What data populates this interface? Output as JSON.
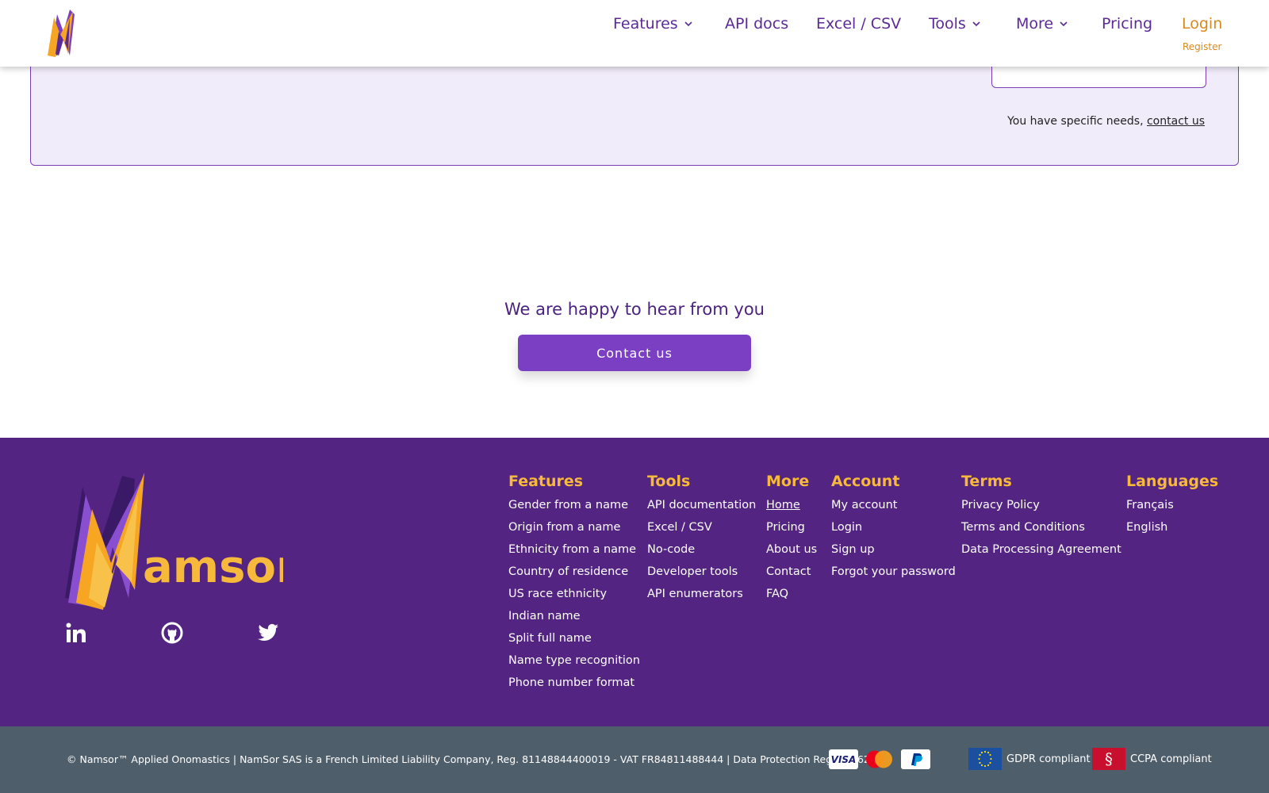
{
  "header": {
    "nav": {
      "features": "Features",
      "api_docs": "API docs",
      "excel_csv": "Excel / CSV",
      "tools": "Tools",
      "more": "More",
      "pricing": "Pricing",
      "login": "Login",
      "register": "Register"
    },
    "logo_icon": "namsor-bolt-logo"
  },
  "panel": {
    "needs_text": "You have specific needs, ",
    "contact_link": "contact us"
  },
  "cta": {
    "title": "We are happy to hear from you",
    "button": "Contact us"
  },
  "footer": {
    "brand": "amsor",
    "social": [
      "linkedin-icon",
      "github-icon",
      "twitter-icon"
    ],
    "columns": {
      "features": {
        "title": "Features",
        "items": [
          "Gender from a name",
          "Origin from a name",
          "Ethnicity from a name",
          "Country of residence",
          "US race ethnicity",
          "Indian name",
          "Split full name",
          "Name type recognition",
          "Phone number format"
        ]
      },
      "tools": {
        "title": "Tools",
        "items": [
          "API documentation",
          "Excel / CSV",
          "No-code",
          "Developer tools",
          "API enumerators"
        ]
      },
      "more": {
        "title": "More",
        "items": [
          "Home",
          "Pricing",
          "About us",
          "Contact",
          "FAQ"
        ]
      },
      "account": {
        "title": "Account",
        "items": [
          "My account",
          "Login",
          "Sign up",
          "Forgot your password"
        ]
      },
      "terms": {
        "title": "Terms",
        "items": [
          "Privacy Policy",
          "Terms and Conditions",
          "Data Processing Agreement"
        ]
      },
      "languages": {
        "title": "Languages",
        "items": [
          "Français",
          "English"
        ]
      }
    }
  },
  "bottom": {
    "copyright": "© Namsor™ Applied Onomastics | NamSor SAS is a French Limited Liability Company, Reg. 81148844400019 - VAT FR84811488444 | Data Protection Reg. 1876223",
    "payments": [
      "visa-icon",
      "mastercard-icon",
      "paypal-icon"
    ],
    "visa_label": "VISA",
    "gdpr": "GDPR compliant",
    "ccpa": "CCPA compliant",
    "ccpa_symbol": "§"
  },
  "colors": {
    "brand_purple": "#532481",
    "accent_orange": "#f6b93b",
    "button_purple": "#7a3fc2",
    "login_orange": "#d88a1d",
    "bottom_gray": "#4f5e6b"
  }
}
